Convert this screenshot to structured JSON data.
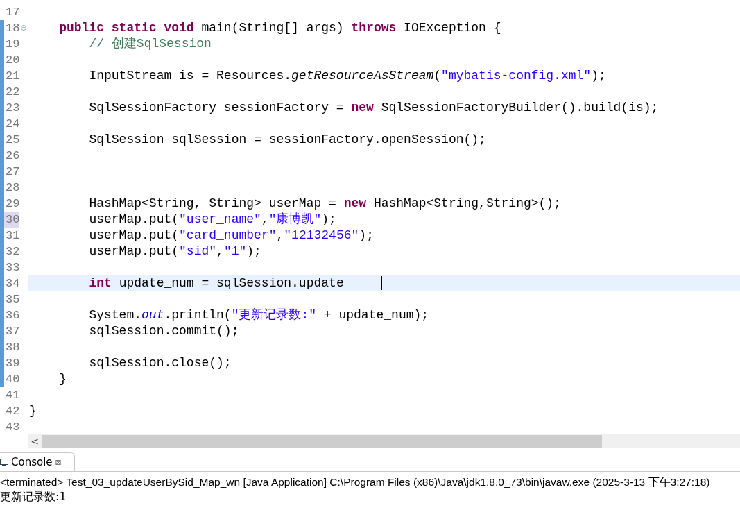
{
  "editor": {
    "lines": [
      {
        "number": "17",
        "changed": false
      },
      {
        "number": "18",
        "changed": true,
        "fold": true,
        "tokens": [
          {
            "text": "    public static void",
            "kind": "keyword"
          },
          {
            "text": " main(String[] args) ",
            "kind": "plain"
          },
          {
            "text": "throws",
            "kind": "keyword"
          },
          {
            "text": " IOException {",
            "kind": "plain"
          }
        ]
      },
      {
        "number": "19",
        "changed": true,
        "tokens": [
          {
            "text": "        // 创建SqlSession",
            "kind": "comment"
          }
        ]
      },
      {
        "number": "20",
        "changed": true
      },
      {
        "number": "21",
        "changed": true,
        "tokens": [
          {
            "text": "        InputStream is = Resources.",
            "kind": "plain"
          },
          {
            "text": "getResourceAsStream",
            "kind": "static"
          },
          {
            "text": "(",
            "kind": "plain"
          },
          {
            "text": "\"mybatis-config.xml\"",
            "kind": "string"
          },
          {
            "text": ");",
            "kind": "plain"
          }
        ]
      },
      {
        "number": "22",
        "changed": true
      },
      {
        "number": "23",
        "changed": true,
        "tokens": [
          {
            "text": "        SqlSessionFactory sessionFactory = ",
            "kind": "plain"
          },
          {
            "text": "new",
            "kind": "keyword"
          },
          {
            "text": " SqlSessionFactoryBuilder().build(is);",
            "kind": "plain"
          }
        ]
      },
      {
        "number": "24",
        "changed": true
      },
      {
        "number": "25",
        "changed": true,
        "tokens": [
          {
            "text": "        SqlSession sqlSession = sessionFactory.openSession();",
            "kind": "plain"
          }
        ]
      },
      {
        "number": "26",
        "changed": true
      },
      {
        "number": "27",
        "changed": true
      },
      {
        "number": "28",
        "changed": true
      },
      {
        "number": "29",
        "changed": true,
        "tokens": [
          {
            "text": "        HashMap<String, String> userMap = ",
            "kind": "plain"
          },
          {
            "text": "new",
            "kind": "keyword"
          },
          {
            "text": " HashMap<String,String>();",
            "kind": "plain"
          }
        ]
      },
      {
        "number": "30",
        "changed": true,
        "marked": true,
        "tokens": [
          {
            "text": "        userMap.put(",
            "kind": "plain"
          },
          {
            "text": "\"user_name\"",
            "kind": "string"
          },
          {
            "text": ",",
            "kind": "plain"
          },
          {
            "text": "\"康博凯\"",
            "kind": "string"
          },
          {
            "text": ");",
            "kind": "plain"
          }
        ]
      },
      {
        "number": "31",
        "changed": true,
        "tokens": [
          {
            "text": "        userMap.put(",
            "kind": "plain"
          },
          {
            "text": "\"card_number\"",
            "kind": "string"
          },
          {
            "text": ",",
            "kind": "plain"
          },
          {
            "text": "\"12132456\"",
            "kind": "string"
          },
          {
            "text": ");",
            "kind": "plain"
          }
        ]
      },
      {
        "number": "32",
        "changed": true,
        "tokens": [
          {
            "text": "        userMap.put(",
            "kind": "plain"
          },
          {
            "text": "\"sid\"",
            "kind": "string"
          },
          {
            "text": ",",
            "kind": "plain"
          },
          {
            "text": "\"1\"",
            "kind": "string"
          },
          {
            "text": ");",
            "kind": "plain"
          }
        ]
      },
      {
        "number": "33",
        "changed": true
      },
      {
        "number": "34",
        "changed": true,
        "current": true,
        "tokens": [
          {
            "text": "        int",
            "kind": "keyword"
          },
          {
            "text": " update_num = sqlSession.update     ",
            "kind": "plain"
          }
        ]
      },
      {
        "number": "35",
        "changed": true
      },
      {
        "number": "36",
        "changed": true,
        "tokens": [
          {
            "text": "        System.",
            "kind": "plain"
          },
          {
            "text": "out",
            "kind": "field"
          },
          {
            "text": ".println(",
            "kind": "plain"
          },
          {
            "text": "\"更新记录数:\"",
            "kind": "string"
          },
          {
            "text": " + update_num);",
            "kind": "plain"
          }
        ]
      },
      {
        "number": "37",
        "changed": true,
        "tokens": [
          {
            "text": "        sqlSession.commit();",
            "kind": "plain"
          }
        ]
      },
      {
        "number": "38",
        "changed": true
      },
      {
        "number": "39",
        "changed": true,
        "tokens": [
          {
            "text": "        sqlSession.close();",
            "kind": "plain"
          }
        ]
      },
      {
        "number": "40",
        "changed": true,
        "tokens": [
          {
            "text": "    }",
            "kind": "plain"
          }
        ]
      },
      {
        "number": "41",
        "changed": false
      },
      {
        "number": "42",
        "changed": false,
        "tokens": [
          {
            "text": "}",
            "kind": "plain"
          }
        ]
      },
      {
        "number": "43",
        "changed": false
      }
    ],
    "scroll_left": "<"
  },
  "console": {
    "tab": {
      "label": "Console",
      "close": "⊠"
    },
    "status": "<terminated> Test_03_updateUserBySid_Map_wn [Java Application] C:\\Program Files (x86)\\Java\\jdk1.8.0_73\\bin\\javaw.exe (2025-3-13 下午3:27:18)",
    "output": [
      "更新记录数:1"
    ]
  }
}
